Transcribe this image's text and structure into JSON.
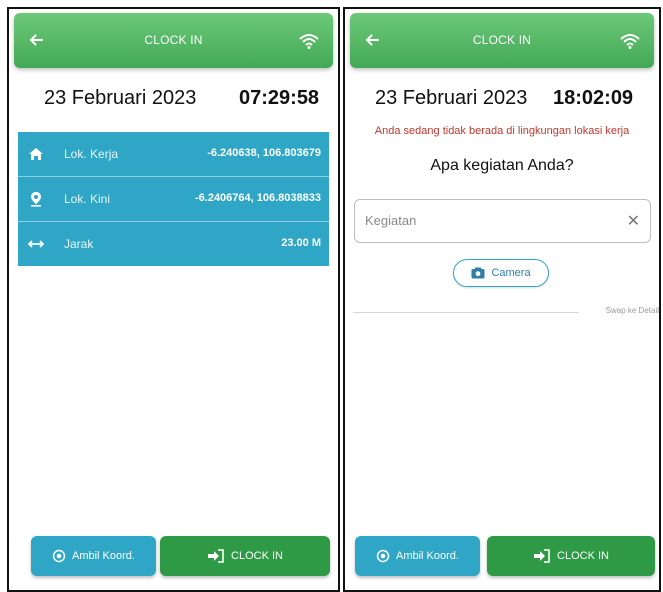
{
  "left": {
    "header": {
      "title": "CLOCK IN"
    },
    "date": "23 Februari 2023",
    "time": "07:29:58",
    "info_rows": [
      {
        "icon": "home-icon",
        "label": "Lok. Kerja",
        "value": "-6.240638, 106.803679"
      },
      {
        "icon": "location-pin-icon",
        "label": "Lok. Kini",
        "value": "-6.2406764, 106.8038833"
      },
      {
        "icon": "distance-arrows-icon",
        "label": "Jarak",
        "value": "23.00 M"
      }
    ],
    "buttons": {
      "koord_label": "Ambil Koord.",
      "clock_label": "CLOCK IN"
    }
  },
  "right": {
    "header": {
      "title": "CLOCK IN"
    },
    "date": "23 Februari 2023",
    "time": "18:02:09",
    "warning": "Anda sedang tidak berada di lingkungan lokasi kerja",
    "question": "Apa kegiatan Anda?",
    "kegiatan_placeholder": "Kegiatan",
    "camera_label": "Camera",
    "swap_text": "Swap ke Detail",
    "buttons": {
      "koord_label": "Ambil Koord.",
      "clock_label": "CLOCK IN"
    }
  },
  "colors": {
    "header_green": "#4caf5c",
    "info_blue": "#2fa6c5",
    "clock_green": "#2f9a45",
    "warning_red": "#c0392b"
  }
}
